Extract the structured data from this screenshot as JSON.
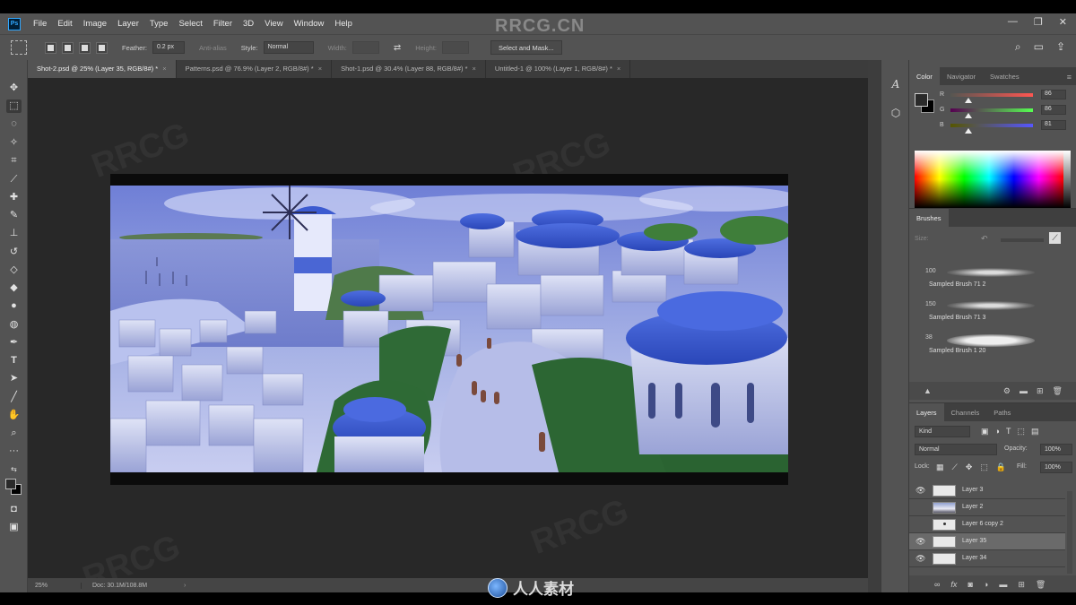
{
  "app": {
    "logo_text": "Ps",
    "watermark_top": "RRCG.CN",
    "watermark_bottom": "人人素材"
  },
  "menubar": {
    "items": [
      "File",
      "Edit",
      "Image",
      "Layer",
      "Type",
      "Select",
      "Filter",
      "3D",
      "View",
      "Window",
      "Help"
    ],
    "window_controls": [
      "—",
      "❐",
      "✕"
    ]
  },
  "options": {
    "feather_label": "Feather:",
    "feather_value": "0.2 px",
    "antialias_label": "Anti-alias",
    "style_label": "Style:",
    "style_value": "Normal",
    "width_label": "Width:",
    "height_label": "Height:",
    "select_mask_label": "Select and Mask..."
  },
  "tabs": [
    {
      "label": "Shot-2.psd @ 25% (Layer 35, RGB/8#) *",
      "active": true
    },
    {
      "label": "Patterns.psd @ 76.9% (Layer 2, RGB/8#) *",
      "active": false
    },
    {
      "label": "Shot-1.psd @ 30.4% (Layer 88, RGB/8#) *",
      "active": false
    },
    {
      "label": "Untitled-1 @ 100% (Layer 1, RGB/8#) *",
      "active": false
    }
  ],
  "tools": [
    "move",
    "marquee",
    "lasso",
    "magic-wand",
    "crop",
    "eyedropper",
    "healing",
    "brush",
    "clone-stamp",
    "history-brush",
    "eraser",
    "paint-bucket",
    "blur",
    "dodge",
    "pen",
    "type",
    "path-selection",
    "line",
    "hand",
    "zoom",
    "more"
  ],
  "status": {
    "zoom": "25%",
    "doc_info": "Doc: 30.1M/108.8M",
    "arrow": "›"
  },
  "color_panel": {
    "tabs": [
      "Color",
      "Navigator",
      "Swatches"
    ],
    "r_label": "R",
    "g_label": "G",
    "b_label": "B",
    "r_value": "86",
    "g_value": "86",
    "b_value": "81",
    "colors": {
      "fg": "#2a2a2a",
      "bg": "#000000"
    }
  },
  "brushes_panel": {
    "title": "Brushes",
    "size_label": "Size:",
    "brushes": [
      {
        "size": "100",
        "name": "Sampled Brush 71 2"
      },
      {
        "size": "150",
        "name": "Sampled Brush 71 3"
      },
      {
        "size": "38",
        "name": "Sampled Brush 1 20"
      }
    ]
  },
  "layers_panel": {
    "tabs": [
      "Layers",
      "Channels",
      "Paths"
    ],
    "kind_label": "Kind",
    "blend_mode": "Normal",
    "opacity_label": "Opacity:",
    "opacity_value": "100%",
    "lock_label": "Lock:",
    "fill_label": "Fill:",
    "fill_value": "100%",
    "layers": [
      {
        "name": "Layer 3",
        "visible": true,
        "selected": false
      },
      {
        "name": "Layer 2",
        "visible": false,
        "selected": false
      },
      {
        "name": "Layer 6 copy 2",
        "visible": false,
        "selected": false
      },
      {
        "name": "Layer 35",
        "visible": true,
        "selected": true
      },
      {
        "name": "Layer 34",
        "visible": true,
        "selected": false
      }
    ]
  }
}
